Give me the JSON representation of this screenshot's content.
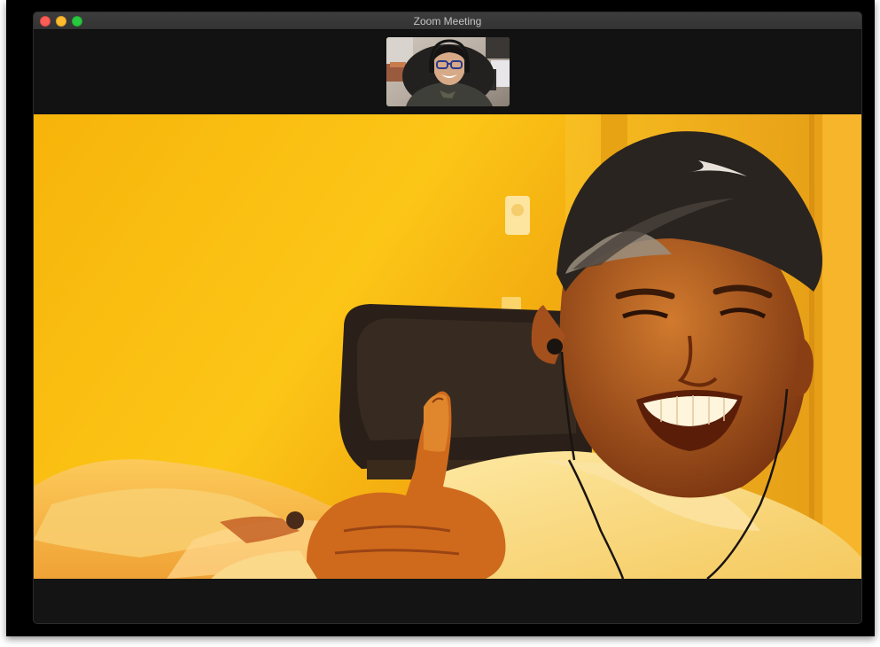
{
  "window": {
    "title": "Zoom Meeting"
  },
  "colors": {
    "window_background": "#151515",
    "titlebar": "#383838",
    "close": "#fd5f57",
    "minimize": "#febc2e",
    "zoom": "#28c840",
    "main_video_tone": "#f2b10c"
  },
  "participants": {
    "thumbnail_view": "participant-thumbnail",
    "active_speaker_view": "active-speaker-video"
  }
}
